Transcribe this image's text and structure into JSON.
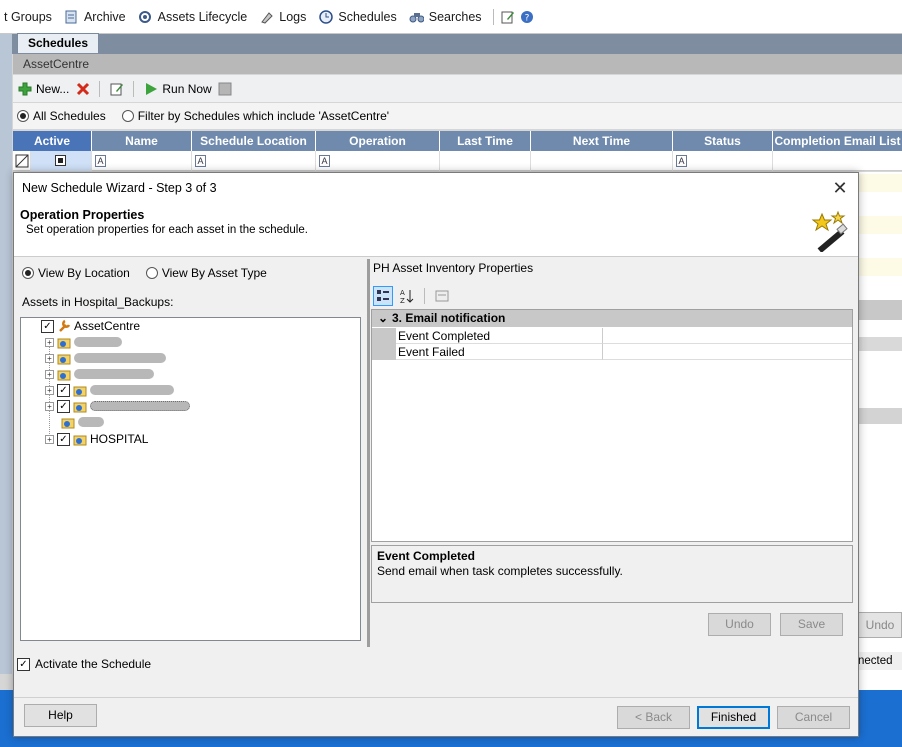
{
  "toolbar": {
    "items": [
      {
        "label": "t Groups",
        "icon": "groups-icon"
      },
      {
        "label": "Archive",
        "icon": "archive-icon"
      },
      {
        "label": "Assets Lifecycle",
        "icon": "lifecycle-icon"
      },
      {
        "label": "Logs",
        "icon": "logs-icon"
      },
      {
        "label": "Schedules",
        "icon": "clock-icon"
      },
      {
        "label": "Searches",
        "icon": "binoculars-icon"
      }
    ]
  },
  "tab": {
    "label": "Schedules"
  },
  "breadcrumb": {
    "label": "AssetCentre"
  },
  "actions": {
    "new_label": "New...",
    "run_now_label": "Run Now"
  },
  "filter": {
    "all_label": "All Schedules",
    "filter_label": "Filter by Schedules which include 'AssetCentre'",
    "selected": "all"
  },
  "grid": {
    "columns": [
      "Active",
      "Name",
      "Schedule Location",
      "Operation",
      "Last Time",
      "Next Time",
      "Status",
      "Completion Email List"
    ]
  },
  "background": {
    "undo_label": "Undo",
    "status_text": "nected"
  },
  "dialog": {
    "title": "New Schedule Wizard - Step 3 of 3",
    "heading": "Operation Properties",
    "subheading": "Set operation properties for each asset in the schedule.",
    "view_by_location": "View By Location",
    "view_by_asset_type": "View By Asset Type",
    "assets_label": "Assets in Hospital_Backups:",
    "tree": {
      "root": "AssetCentre",
      "hospital": "HOSPITAL"
    },
    "props": {
      "title": "PH Asset Inventory Properties",
      "category": "3. Email notification",
      "rows": [
        {
          "name": "Event Completed",
          "value": ""
        },
        {
          "name": "Event Failed",
          "value": ""
        }
      ],
      "desc_title": "Event Completed",
      "desc_text": "Send email when task completes successfully."
    },
    "undo_label": "Undo",
    "save_label": "Save",
    "activate_label": "Activate the Schedule",
    "activate_checked": true,
    "help_label": "Help",
    "back_label": "< Back",
    "finished_label": "Finished",
    "cancel_label": "Cancel"
  },
  "colors": {
    "accent": "#0078d7",
    "grid_header": "#6f8aad",
    "taskbar": "#1b6fd1"
  }
}
